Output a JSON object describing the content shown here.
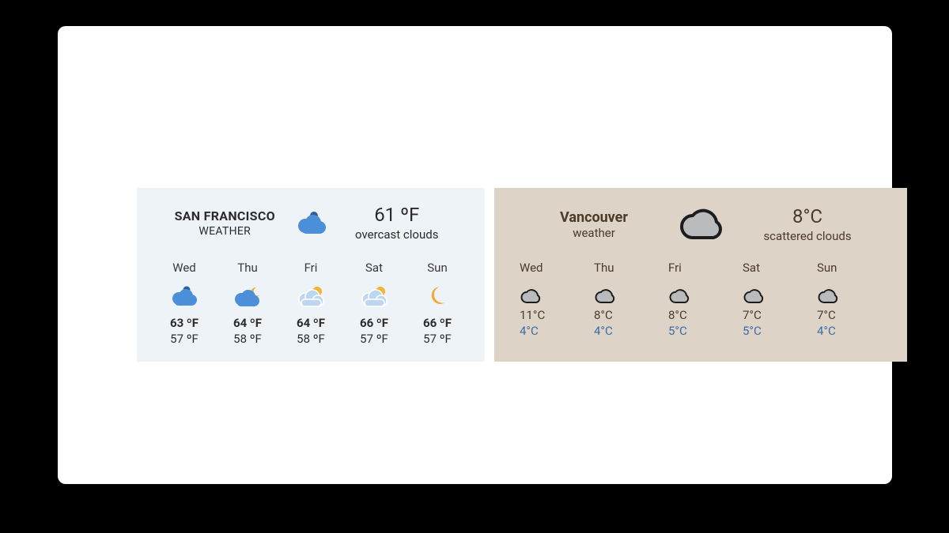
{
  "sf": {
    "city": "SAN FRANCISCO",
    "subtitle": "WEATHER",
    "current_temp": "61 ºF",
    "current_desc": "overcast clouds",
    "days": [
      {
        "name": "Wed",
        "icon": "cloud",
        "hi": "63 ºF",
        "lo": "57 ºF"
      },
      {
        "name": "Thu",
        "icon": "cloud-moon",
        "hi": "64 ºF",
        "lo": "58 ºF"
      },
      {
        "name": "Fri",
        "icon": "cloud-sun",
        "hi": "64 ºF",
        "lo": "58 ºF"
      },
      {
        "name": "Sat",
        "icon": "cloud-sun",
        "hi": "66 ºF",
        "lo": "57 ºF"
      },
      {
        "name": "Sun",
        "icon": "moon",
        "hi": "66 ºF",
        "lo": "57 ºF"
      }
    ]
  },
  "van": {
    "city": "Vancouver",
    "subtitle": "weather",
    "current_temp": "8°C",
    "current_desc": "scattered clouds",
    "days": [
      {
        "name": "Wed",
        "icon": "cloud-outline",
        "hi": "11°C",
        "lo": "4°C"
      },
      {
        "name": "Thu",
        "icon": "cloud-outline",
        "hi": "8°C",
        "lo": "4°C"
      },
      {
        "name": "Fri",
        "icon": "cloud-outline",
        "hi": "8°C",
        "lo": "5°C"
      },
      {
        "name": "Sat",
        "icon": "cloud-outline",
        "hi": "7°C",
        "lo": "5°C"
      },
      {
        "name": "Sun",
        "icon": "cloud-outline",
        "hi": "7°C",
        "lo": "4°C"
      }
    ]
  }
}
